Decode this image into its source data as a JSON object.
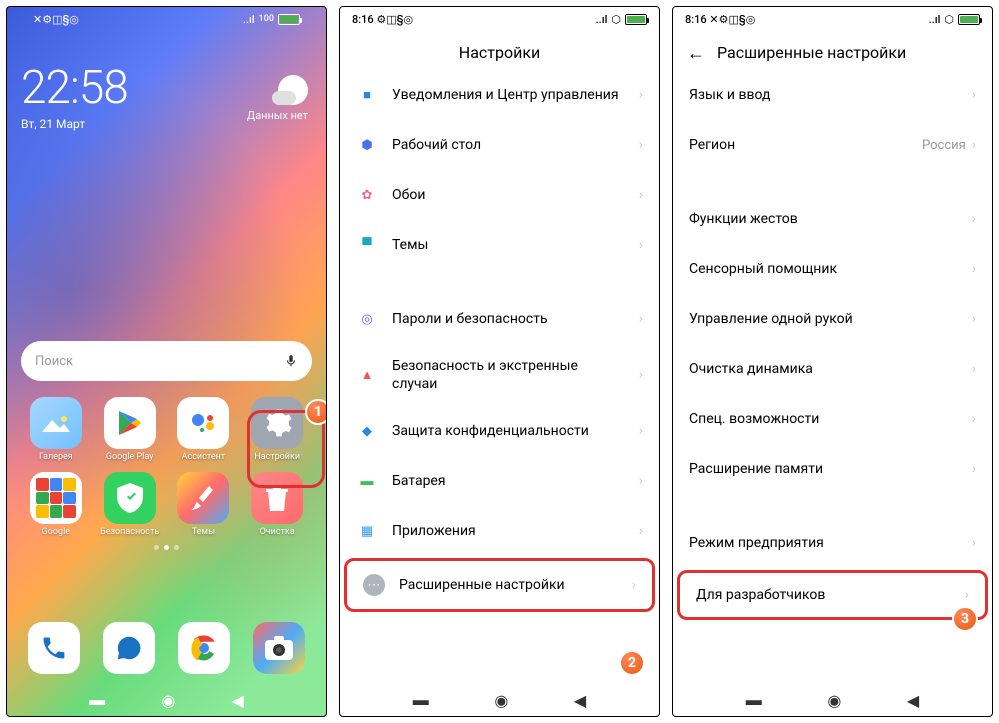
{
  "screen1": {
    "status_left": "✕⚙◫§◎",
    "signal": "..ıl",
    "wifi": "⬡",
    "battery_pct": "100",
    "clock": "22:58",
    "date": "Вт, 21 Март",
    "weather_label": "Данных нет",
    "search_placeholder": "Поиск",
    "apps_row1": [
      {
        "label": "Галерея"
      },
      {
        "label": "Google Play"
      },
      {
        "label": "Ассистент"
      },
      {
        "label": "Настройки"
      }
    ],
    "apps_row2": [
      {
        "label": "Google"
      },
      {
        "label": "Безопасность"
      },
      {
        "label": "Темы"
      },
      {
        "label": "Очистка"
      }
    ],
    "badge": "1"
  },
  "screen2": {
    "status_time": "8:16",
    "status_icons": "⚙◫§◎",
    "title": "Настройки",
    "items": [
      {
        "label": "Уведомления и Центр управления",
        "iconColor": "#228be6",
        "glyph": "■"
      },
      {
        "label": "Рабочий стол",
        "iconColor": "#4c6ef5",
        "glyph": "⬢"
      },
      {
        "label": "Обои",
        "iconColor": "#f06595",
        "glyph": "✿"
      },
      {
        "label": "Темы",
        "iconColor": "#15aabf",
        "glyph": "▀"
      }
    ],
    "items2": [
      {
        "label": "Пароли и безопасность",
        "iconColor": "#7950f2",
        "glyph": "◎"
      },
      {
        "label": "Безопасность и экстренные случаи",
        "iconColor": "#fa5252",
        "glyph": "▲"
      },
      {
        "label": "Защита конфиденциальности",
        "iconColor": "#228be6",
        "glyph": "◆"
      },
      {
        "label": "Батарея",
        "iconColor": "#40c057",
        "glyph": "▬"
      },
      {
        "label": "Приложения",
        "iconColor": "#339af0",
        "glyph": "▦"
      },
      {
        "label": "Расширенные настройки",
        "iconColor": "#868e96",
        "glyph": "⋯"
      }
    ],
    "badge": "2"
  },
  "screen3": {
    "status_time": "8:16",
    "status_icons": "✕⚙◫§◎",
    "title": "Расширенные настройки",
    "items": [
      {
        "label": "Язык и ввод"
      },
      {
        "label": "Регион",
        "value": "Россия"
      }
    ],
    "items2": [
      {
        "label": "Функции жестов"
      },
      {
        "label": "Сенсорный помощник"
      },
      {
        "label": "Управление одной рукой"
      },
      {
        "label": "Очистка динамика"
      },
      {
        "label": "Спец. возможности"
      },
      {
        "label": "Расширение памяти"
      }
    ],
    "items3": [
      {
        "label": "Режим предприятия"
      },
      {
        "label": "Для разработчиков"
      }
    ],
    "badge": "3"
  }
}
